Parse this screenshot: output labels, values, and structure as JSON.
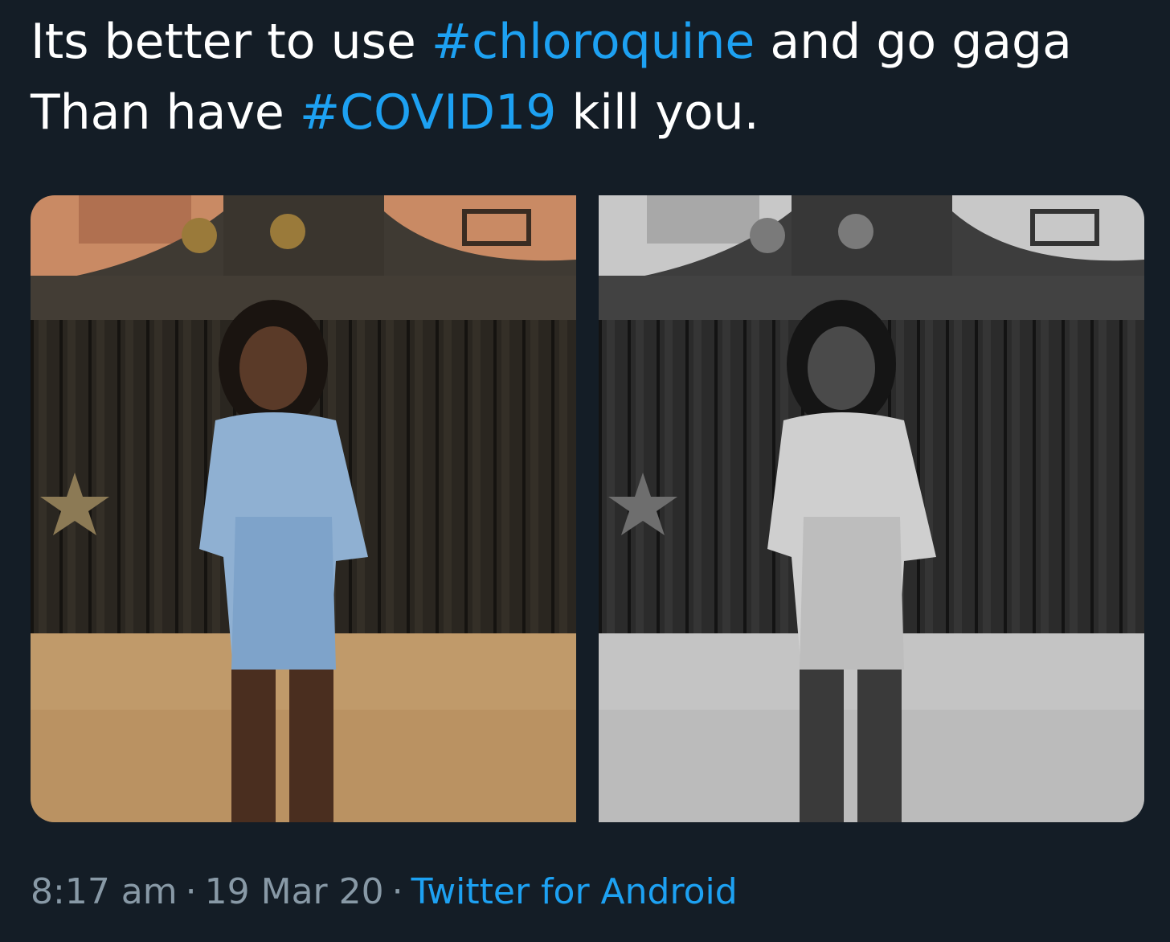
{
  "tweet": {
    "line1_pre": "Its better to use ",
    "hashtag1": "#chloroquine",
    "line1_post": " and go gaga",
    "line2_pre": "Than have ",
    "hashtag2": "#COVID19",
    "line2_post": " kill you."
  },
  "media": {
    "count": 2,
    "photos": [
      {
        "style": "color"
      },
      {
        "style": "grayscale"
      }
    ]
  },
  "meta": {
    "time": "8:17 am",
    "sep1": "·",
    "date": "19 Mar 20",
    "sep2": "·",
    "source": "Twitter for Android"
  },
  "colors": {
    "background": "#141d26",
    "text": "#ffffff",
    "link": "#1da1f2",
    "muted": "#8899a6"
  }
}
